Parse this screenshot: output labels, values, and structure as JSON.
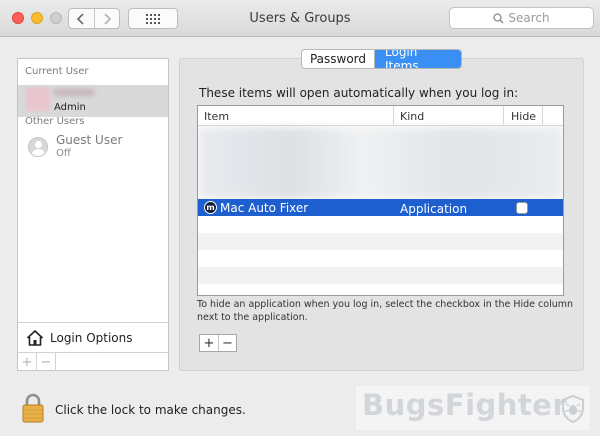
{
  "window": {
    "title": "Users & Groups"
  },
  "search": {
    "placeholder": "Search"
  },
  "sidebar": {
    "current_user_label": "Current User",
    "current_user": {
      "name": "Admin"
    },
    "other_users_label": "Other Users",
    "other_users": [
      {
        "name": "Guest User",
        "status": "Off"
      }
    ],
    "login_options": "Login Options",
    "add_label": "+",
    "remove_label": "−"
  },
  "tabs": [
    {
      "label": "Password",
      "selected": false
    },
    {
      "label": "Login Items",
      "selected": true
    }
  ],
  "login_items": {
    "heading": "These items will open automatically when you log in:",
    "columns": {
      "item": "Item",
      "kind": "Kind",
      "hide": "Hide"
    },
    "rows": [
      {
        "item": "Mac Auto Fixer",
        "kind": "Application",
        "hide": false,
        "selected": true
      }
    ],
    "hint": "To hide an application when you log in, select the checkbox in the Hide column next to the application.",
    "add_label": "+",
    "remove_label": "−"
  },
  "footer": {
    "lock_text": "Click the lock to make changes."
  },
  "watermark": {
    "text": "BugsFighter"
  },
  "colors": {
    "accent": "#3a8ff5",
    "selection": "#1e5fcf"
  }
}
